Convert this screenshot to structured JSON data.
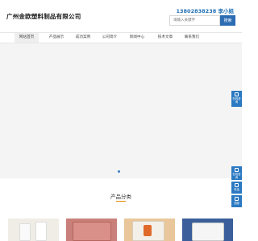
{
  "header": {
    "company_name": "广州金欧塑料制品有限公司",
    "phone": "13802838238 李小姐",
    "search": {
      "placeholder": "请输入关键字",
      "button_label": "搜索"
    }
  },
  "nav": {
    "items": [
      {
        "label": "网站首页",
        "active": true
      },
      {
        "label": "产品展示",
        "active": false
      },
      {
        "label": "成功案例",
        "active": false
      },
      {
        "label": "公司简介",
        "active": false
      },
      {
        "label": "新闻中心",
        "active": false
      },
      {
        "label": "技术文章",
        "active": false
      },
      {
        "label": "联系我们",
        "active": false
      }
    ]
  },
  "banner": {
    "slide_count": 1,
    "active_slide": 1
  },
  "side_tools": {
    "top": {
      "label": "在线咨询",
      "icon": "chat-icon"
    },
    "bottom": [
      {
        "label": "在线咨询",
        "icon": "chat-icon"
      },
      {
        "label": "电话",
        "icon": "phone-icon"
      },
      {
        "label": "顶部",
        "icon": "arrow-up-icon"
      }
    ]
  },
  "section": {
    "title": "产品分类"
  },
  "colors": {
    "accent": "#2b6cb3",
    "underline": "#e08a00"
  }
}
